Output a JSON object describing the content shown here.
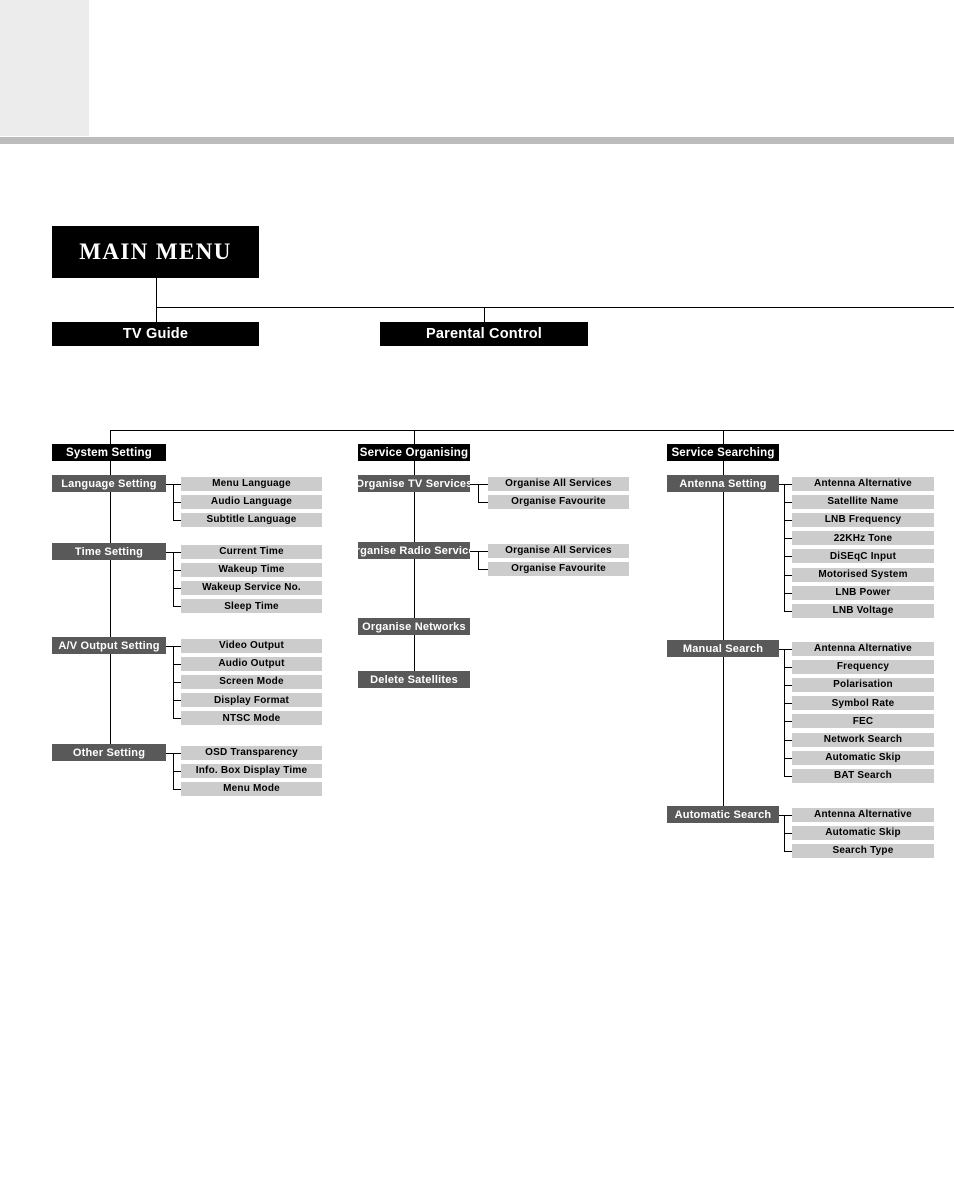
{
  "page": {
    "title": "MAIN MENU",
    "accent_black": "#000000",
    "accent_gray": "#595959",
    "accent_light": "#cccccc",
    "header_block": "#ececec",
    "header_rule": "#bcbcbc"
  },
  "level1": [
    {
      "label": "TV Guide"
    },
    {
      "label": "Parental Control"
    }
  ],
  "columns": [
    {
      "header": "System Setting",
      "groups": [
        {
          "label": "Language Setting",
          "items": [
            "Menu Language",
            "Audio Language",
            "Subtitle Language"
          ]
        },
        {
          "label": "Time Setting",
          "items": [
            "Current Time",
            "Wakeup Time",
            "Wakeup Service No.",
            "Sleep Time"
          ]
        },
        {
          "label": "A/V Output Setting",
          "items": [
            "Video  Output",
            "Audio Output",
            "Screen Mode",
            "Display Format",
            "NTSC Mode"
          ]
        },
        {
          "label": "Other Setting",
          "items": [
            "OSD Transparency",
            "Info. Box Display Time",
            "Menu Mode"
          ]
        }
      ]
    },
    {
      "header": "Service Organising",
      "groups": [
        {
          "label": "Organise TV Services",
          "items": [
            "Organise All Services",
            "Organise Favourite"
          ]
        },
        {
          "label": "Organise Radio Services",
          "items": [
            "Organise All Services",
            "Organise Favourite"
          ]
        },
        {
          "label": "Organise Networks",
          "items": []
        },
        {
          "label": "Delete Satellites",
          "items": []
        }
      ]
    },
    {
      "header": "Service Searching",
      "groups": [
        {
          "label": "Antenna Setting",
          "items": [
            "Antenna Alternative",
            "Satellite Name",
            "LNB Frequency",
            "22KHz Tone",
            "DiSEqC Input",
            "Motorised System",
            "LNB Power",
            "LNB Voltage"
          ]
        },
        {
          "label": "Manual Search",
          "items": [
            "Antenna Alternative",
            "Frequency",
            "Polarisation",
            "Symbol Rate",
            "FEC",
            "Network Search",
            "Automatic Skip",
            "BAT Search"
          ]
        },
        {
          "label": "Automatic Search",
          "items": [
            "Antenna Alternative",
            "Automatic Skip",
            "Search Type"
          ]
        }
      ]
    }
  ]
}
